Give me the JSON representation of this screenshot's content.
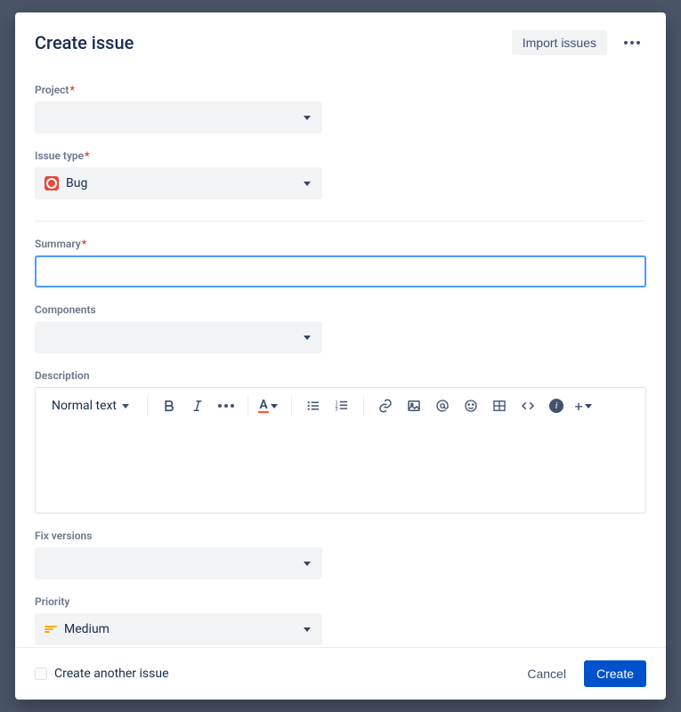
{
  "header": {
    "title": "Create issue",
    "import_label": "Import issues"
  },
  "fields": {
    "project": {
      "label": "Project",
      "value": ""
    },
    "issue_type": {
      "label": "Issue type",
      "value": "Bug"
    },
    "summary": {
      "label": "Summary",
      "value": ""
    },
    "components": {
      "label": "Components",
      "value": ""
    },
    "description": {
      "label": "Description"
    },
    "fix_versions": {
      "label": "Fix versions",
      "value": ""
    },
    "priority": {
      "label": "Priority",
      "value": "Medium"
    }
  },
  "editor": {
    "text_style": "Normal text"
  },
  "footer": {
    "create_another": "Create another issue",
    "cancel": "Cancel",
    "create": "Create"
  }
}
